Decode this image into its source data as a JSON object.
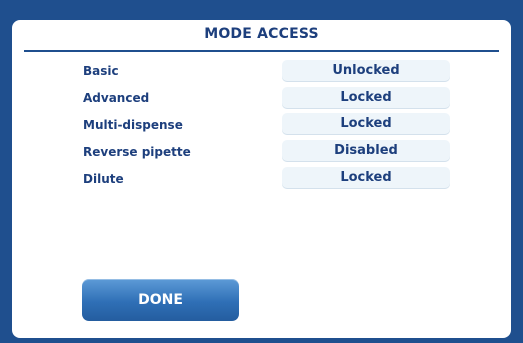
{
  "dialog": {
    "title": "MODE ACCESS",
    "modes": [
      {
        "label": "Basic",
        "state": "Unlocked"
      },
      {
        "label": "Advanced",
        "state": "Locked"
      },
      {
        "label": "Multi-dispense",
        "state": "Locked"
      },
      {
        "label": "Reverse pipette",
        "state": "Disabled"
      },
      {
        "label": "Dilute",
        "state": "Locked"
      }
    ],
    "done_label": "DONE"
  },
  "colors": {
    "frame": "#1f4f8e",
    "text": "#1d3f7d",
    "state_button_bg": "#eef5fa",
    "done_button": "#2f6fb6"
  }
}
